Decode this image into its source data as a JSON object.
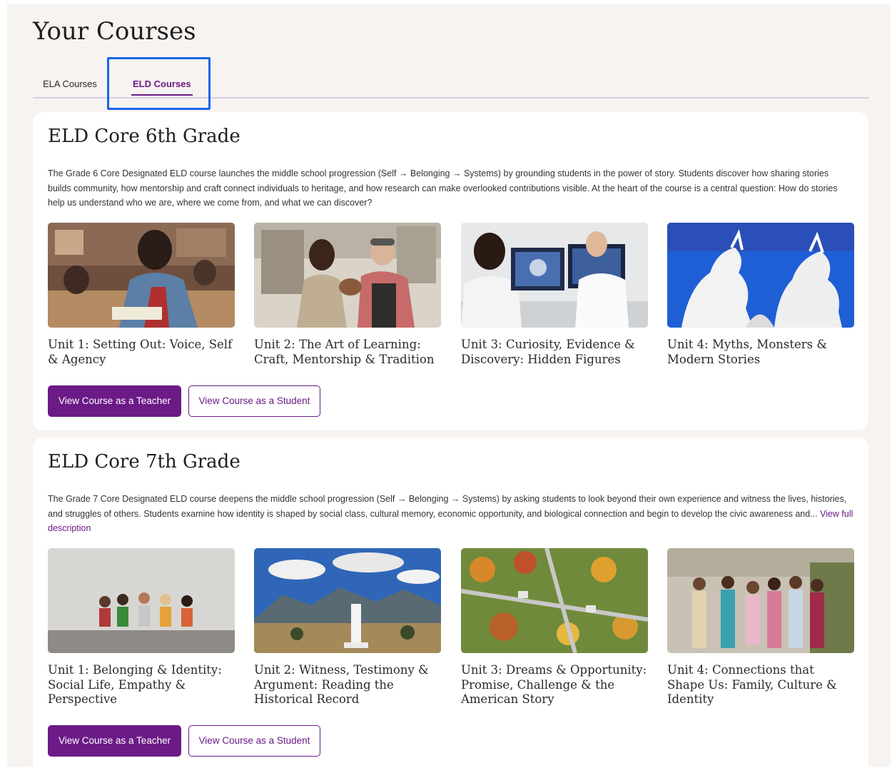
{
  "page": {
    "title": "Your Courses"
  },
  "tabs": [
    {
      "label": "ELA Courses",
      "active": false
    },
    {
      "label": "ELD Courses",
      "active": true
    }
  ],
  "colors": {
    "accent": "#6b1a86",
    "focus": "#1a64ec",
    "background": "#f7f3f0"
  },
  "courses": [
    {
      "title": "ELD Core 6th Grade",
      "description": "The Grade 6 Core Designated ELD course launches the middle school progression (Self → Belonging → Systems) by grounding students in the power of story. Students discover how sharing stories builds community, how mentorship and craft connect individuals to heritage, and how research can make overlooked contributions visible. At the heart of the course is a central question: How do stories help us understand who we are, where we come from, and what we can discover?",
      "description_link": "",
      "units": [
        {
          "title": "Unit 1: Setting Out: Voice, Self & Agency"
        },
        {
          "title": "Unit 2: The Art of Learning: Craft, Mentorship & Tradition"
        },
        {
          "title": "Unit 3: Curiosity, Evidence & Discovery: Hidden Figures"
        },
        {
          "title": "Unit 4: Myths, Monsters & Modern Stories"
        }
      ],
      "teacher_button": "View Course as a Teacher",
      "student_button": "View Course as a Student"
    },
    {
      "title": "ELD Core 7th Grade",
      "description": "The Grade 7 Core Designated ELD course deepens the middle school progression (Self → Belonging → Systems) by asking students to look beyond their own experience and witness the lives, histories, and struggles of others. Students examine how identity is shaped by social class, cultural memory, economic opportunity, and biological connection and begin to develop the civic awareness and... ",
      "description_link": "View full description",
      "units": [
        {
          "title": "Unit 1: Belonging & Identity: Social Life, Empathy & Perspective"
        },
        {
          "title": "Unit 2: Witness, Testimony & Argument: Reading the Historical Record"
        },
        {
          "title": "Unit 3: Dreams & Opportunity: Promise, Challenge & the American Story"
        },
        {
          "title": "Unit 4: Connections that Shape Us: Family, Culture & Identity"
        }
      ],
      "teacher_button": "View Course as a Teacher",
      "student_button": "View Course as a Student"
    }
  ]
}
